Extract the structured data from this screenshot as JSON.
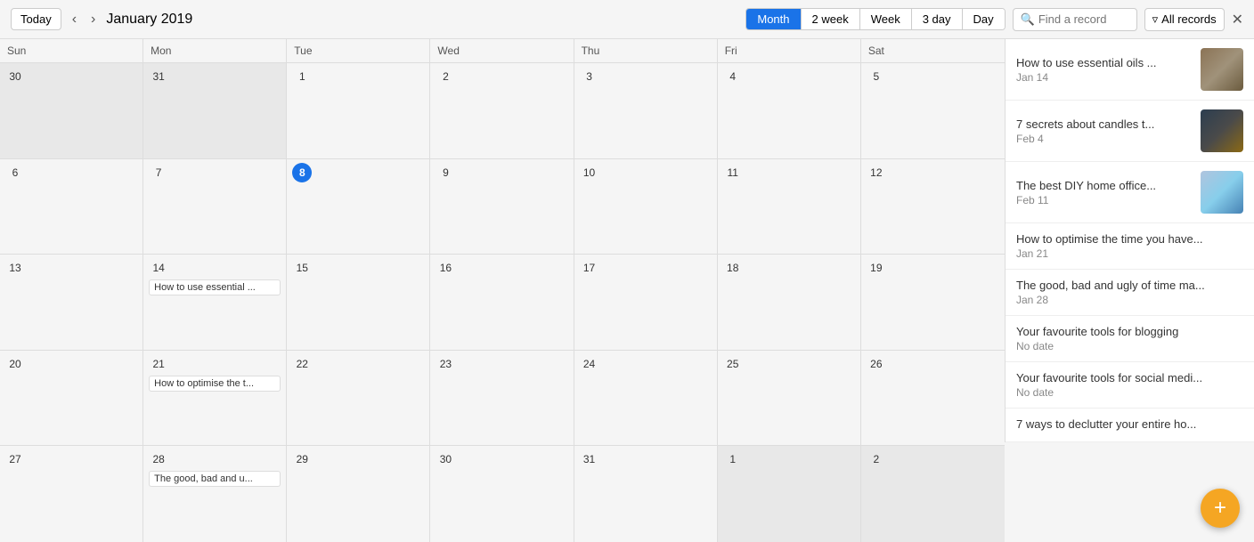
{
  "topbar": {
    "today_label": "Today",
    "month_title": "January 2019",
    "views": [
      {
        "id": "month",
        "label": "Month",
        "active": true
      },
      {
        "id": "2week",
        "label": "2 week",
        "active": false
      },
      {
        "id": "week",
        "label": "Week",
        "active": false
      },
      {
        "id": "3day",
        "label": "3 day",
        "active": false
      },
      {
        "id": "day",
        "label": "Day",
        "active": false
      }
    ],
    "search_placeholder": "Find a record",
    "filter_label": "All records"
  },
  "calendar": {
    "day_headers": [
      "Sun",
      "Mon",
      "Tue",
      "Wed",
      "Thu",
      "Fri",
      "Sat"
    ],
    "weeks": [
      {
        "days": [
          {
            "num": "30",
            "outside": true,
            "today": false,
            "events": []
          },
          {
            "num": "31",
            "outside": true,
            "today": false,
            "events": []
          },
          {
            "num": "1",
            "outside": false,
            "today": false,
            "events": []
          },
          {
            "num": "2",
            "outside": false,
            "today": false,
            "events": []
          },
          {
            "num": "3",
            "outside": false,
            "today": false,
            "events": []
          },
          {
            "num": "4",
            "outside": false,
            "today": false,
            "events": []
          },
          {
            "num": "5",
            "outside": false,
            "today": false,
            "events": []
          }
        ]
      },
      {
        "days": [
          {
            "num": "6",
            "outside": false,
            "today": false,
            "events": []
          },
          {
            "num": "7",
            "outside": false,
            "today": false,
            "events": []
          },
          {
            "num": "8",
            "outside": false,
            "today": true,
            "events": []
          },
          {
            "num": "9",
            "outside": false,
            "today": false,
            "events": []
          },
          {
            "num": "10",
            "outside": false,
            "today": false,
            "events": []
          },
          {
            "num": "11",
            "outside": false,
            "today": false,
            "events": []
          },
          {
            "num": "12",
            "outside": false,
            "today": false,
            "events": []
          }
        ]
      },
      {
        "days": [
          {
            "num": "13",
            "outside": false,
            "today": false,
            "events": []
          },
          {
            "num": "14",
            "outside": false,
            "today": false,
            "events": [
              "How to use essential ..."
            ]
          },
          {
            "num": "15",
            "outside": false,
            "today": false,
            "events": []
          },
          {
            "num": "16",
            "outside": false,
            "today": false,
            "events": []
          },
          {
            "num": "17",
            "outside": false,
            "today": false,
            "events": []
          },
          {
            "num": "18",
            "outside": false,
            "today": false,
            "events": []
          },
          {
            "num": "19",
            "outside": false,
            "today": false,
            "events": []
          }
        ]
      },
      {
        "days": [
          {
            "num": "20",
            "outside": false,
            "today": false,
            "events": []
          },
          {
            "num": "21",
            "outside": false,
            "today": false,
            "events": [
              "How to optimise the t..."
            ]
          },
          {
            "num": "22",
            "outside": false,
            "today": false,
            "events": []
          },
          {
            "num": "23",
            "outside": false,
            "today": false,
            "events": []
          },
          {
            "num": "24",
            "outside": false,
            "today": false,
            "events": []
          },
          {
            "num": "25",
            "outside": false,
            "today": false,
            "events": []
          },
          {
            "num": "26",
            "outside": false,
            "today": false,
            "events": []
          }
        ]
      },
      {
        "days": [
          {
            "num": "27",
            "outside": false,
            "today": false,
            "events": []
          },
          {
            "num": "28",
            "outside": false,
            "today": false,
            "events": [
              "The good, bad and u..."
            ]
          },
          {
            "num": "29",
            "outside": false,
            "today": false,
            "events": []
          },
          {
            "num": "30",
            "outside": false,
            "today": false,
            "events": []
          },
          {
            "num": "31",
            "outside": false,
            "today": false,
            "events": []
          },
          {
            "num": "1",
            "outside": true,
            "today": false,
            "events": []
          },
          {
            "num": "2",
            "outside": true,
            "today": false,
            "events": []
          }
        ]
      }
    ]
  },
  "sidebar": {
    "items": [
      {
        "id": "item1",
        "title": "How to use essential oils ...",
        "date": "Jan 14",
        "has_img": true,
        "img_class": "img-essential"
      },
      {
        "id": "item2",
        "title": "7 secrets about candles t...",
        "date": "Feb 4",
        "has_img": true,
        "img_class": "img-candles"
      },
      {
        "id": "item3",
        "title": "The best DIY home office...",
        "date": "Feb 11",
        "has_img": true,
        "img_class": "img-office"
      },
      {
        "id": "item4",
        "title": "How to optimise the time you have...",
        "date": "Jan 21",
        "has_img": false,
        "img_class": ""
      },
      {
        "id": "item5",
        "title": "The good, bad and ugly of time ma...",
        "date": "Jan 28",
        "has_img": false,
        "img_class": ""
      },
      {
        "id": "item6",
        "title": "Your favourite tools for blogging",
        "date": "No date",
        "has_img": false,
        "img_class": ""
      },
      {
        "id": "item7",
        "title": "Your favourite tools for social medi...",
        "date": "No date",
        "has_img": false,
        "img_class": ""
      },
      {
        "id": "item8",
        "title": "7 ways to declutter your entire ho...",
        "date": "",
        "has_img": false,
        "img_class": ""
      }
    ],
    "fab_icon": "+"
  }
}
